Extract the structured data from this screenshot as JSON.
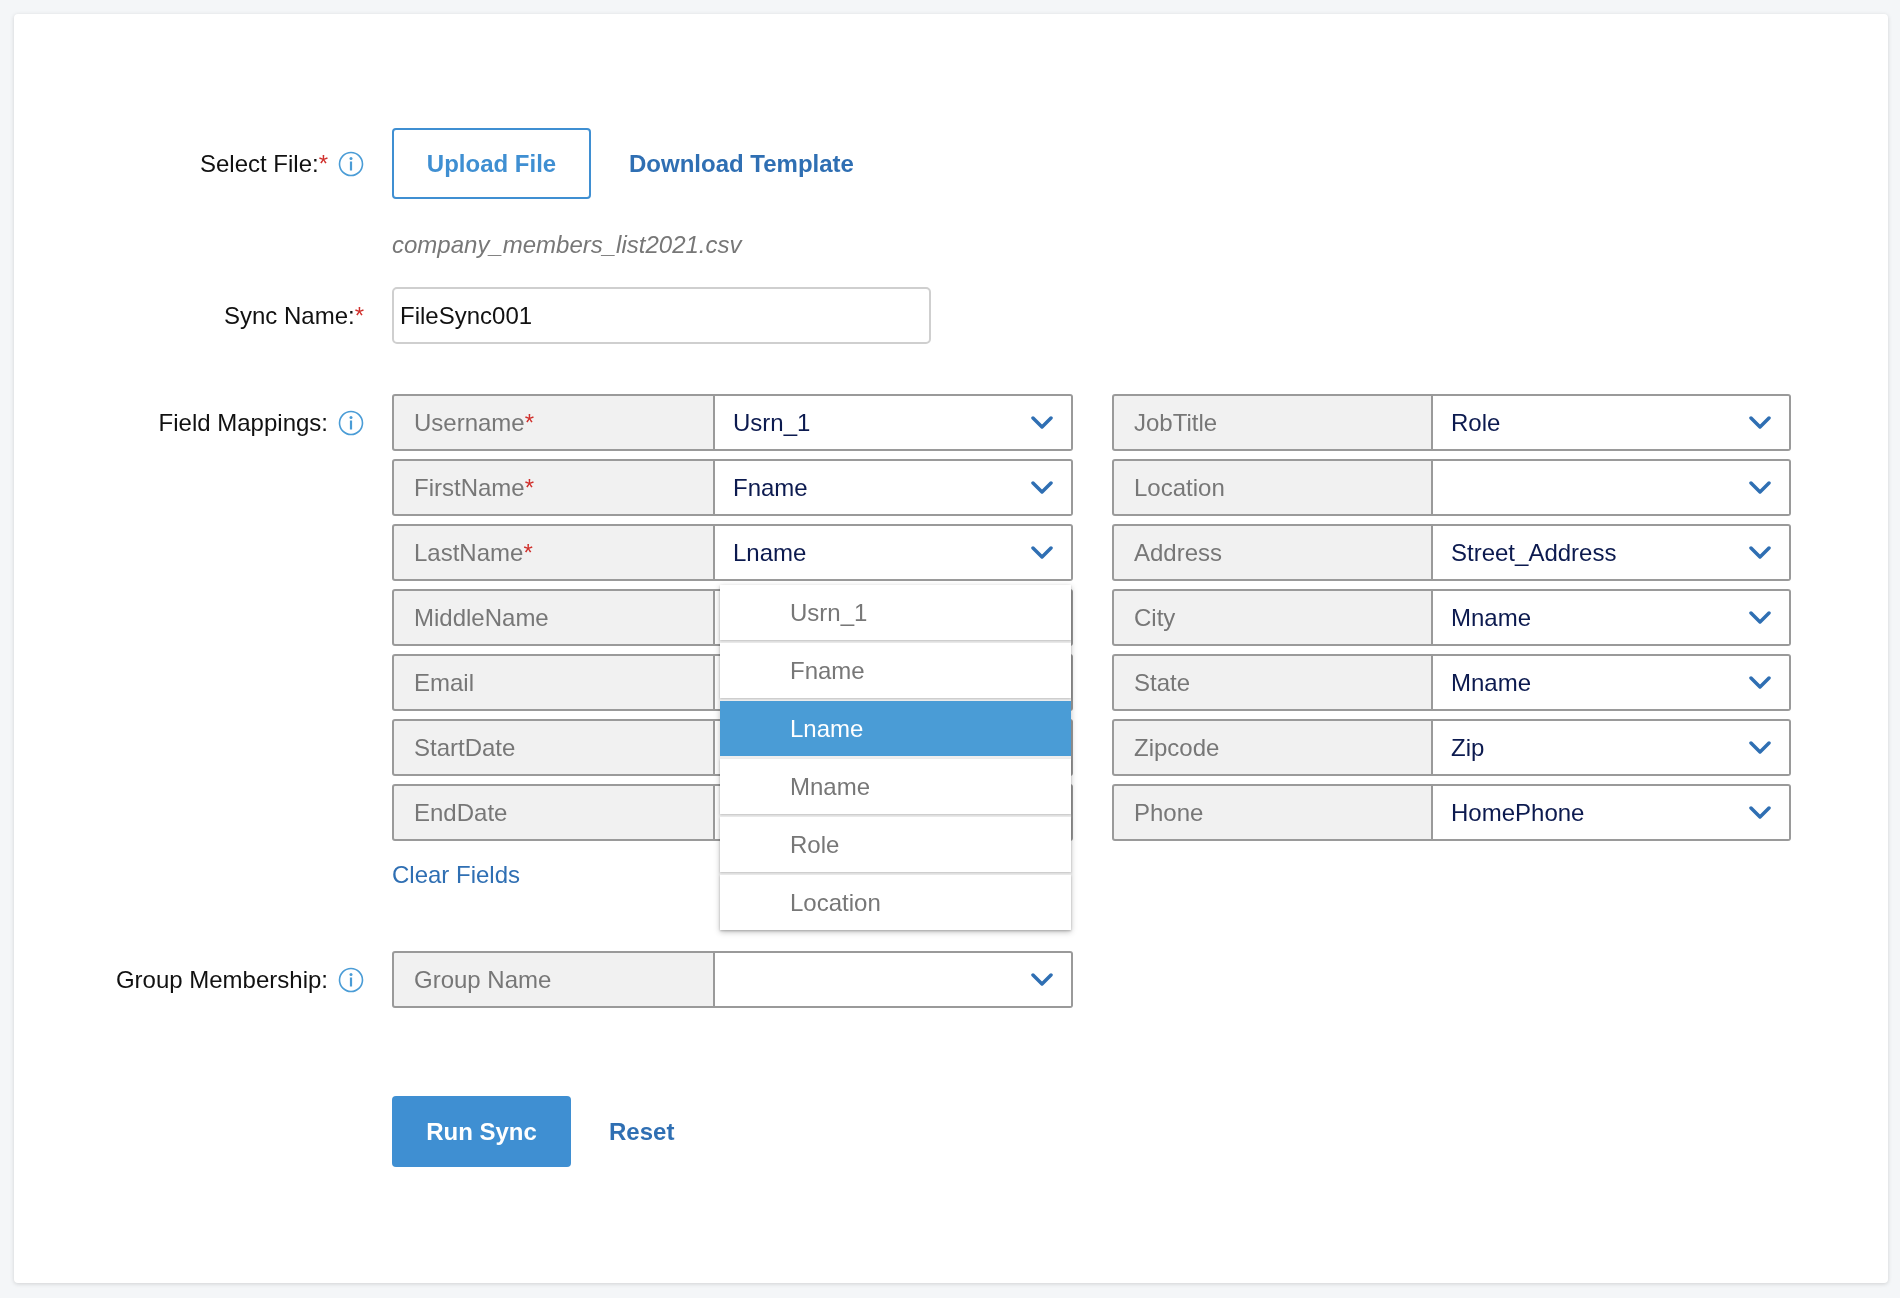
{
  "select_file": {
    "label": "Select File:",
    "required_mark": "*",
    "info": true,
    "upload_button": "Upload File",
    "template_link": "Download Template",
    "file_name": "company_members_list2021.csv"
  },
  "sync_name": {
    "label": "Sync Name:",
    "required_mark": "*",
    "value": "FileSync001"
  },
  "field_mappings": {
    "label": "Field Mappings:",
    "info": true,
    "left": [
      {
        "field": "Username",
        "required_mark": "*",
        "value": "Usrn_1"
      },
      {
        "field": "FirstName",
        "required_mark": "*",
        "value": "Fname"
      },
      {
        "field": "LastName",
        "required_mark": "*",
        "value": "Lname"
      },
      {
        "field": "MiddleName"
      },
      {
        "field": "Email"
      },
      {
        "field": "StartDate"
      },
      {
        "field": "EndDate"
      }
    ],
    "right": [
      {
        "field": "JobTitle",
        "value": "Role"
      },
      {
        "field": "Location"
      },
      {
        "field": "Address",
        "value": "Street_Address"
      },
      {
        "field": "City",
        "value": "Mname"
      },
      {
        "field": "State",
        "value": "Mname"
      },
      {
        "field": "Zipcode",
        "value": "Zip"
      },
      {
        "field": "Phone",
        "value": "HomePhone"
      }
    ],
    "open_list": [
      {
        "label": "Usrn_1",
        "selected": false
      },
      {
        "label": "Fname",
        "selected": false
      },
      {
        "label": "Lname",
        "selected": true
      },
      {
        "label": "Mname",
        "selected": false
      },
      {
        "label": "Role",
        "selected": false
      },
      {
        "label": "Location",
        "selected": false
      }
    ],
    "clear_link": "Clear Fields"
  },
  "group_membership": {
    "label": "Group Membership:",
    "info": true,
    "field": "Group Name"
  },
  "actions": {
    "run_button": "Run Sync",
    "reset_link": "Reset"
  }
}
